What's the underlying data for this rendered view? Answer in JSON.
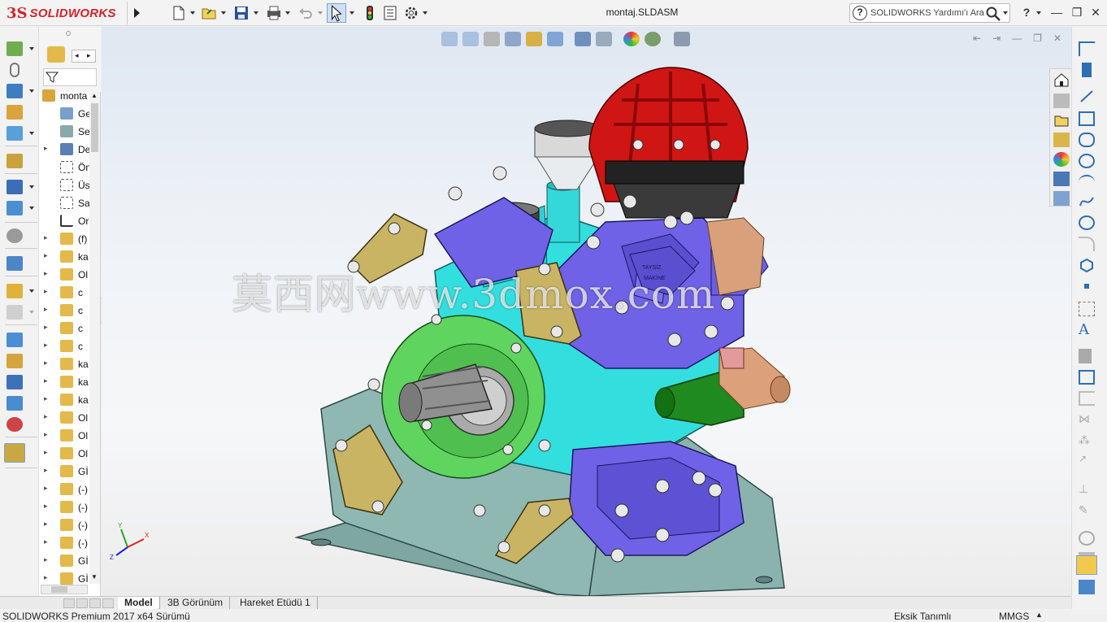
{
  "app": {
    "brand": "SOLIDWORKS",
    "document_title": "montaj.SLDASM",
    "search_placeholder": "SOLIDWORKS Yardımı'ı Ara",
    "help_label": "?"
  },
  "toolbar": {
    "icons": [
      "new-icon",
      "open-icon",
      "save-icon",
      "print-icon",
      "undo-icon",
      "select-icon",
      "rebuild-icon",
      "file-properties-icon",
      "options-icon"
    ]
  },
  "feature_tree": {
    "root_label": "monta",
    "items": [
      {
        "label": "Ge",
        "icon": "history-icon"
      },
      {
        "label": "Se",
        "icon": "sensors-icon"
      },
      {
        "label": "De",
        "icon": "annotations-icon"
      },
      {
        "label": "Ön",
        "icon": "plane-icon"
      },
      {
        "label": "Üs",
        "icon": "plane-icon"
      },
      {
        "label": "Sa",
        "icon": "plane-icon"
      },
      {
        "label": "Or",
        "icon": "origin-icon"
      },
      {
        "label": "(f)",
        "icon": "part-icon"
      },
      {
        "label": "ka",
        "icon": "part-icon"
      },
      {
        "label": "Ol",
        "icon": "part-icon"
      },
      {
        "label": "c",
        "icon": "part-icon"
      },
      {
        "label": "c",
        "icon": "part-icon"
      },
      {
        "label": "c",
        "icon": "part-icon"
      },
      {
        "label": "c",
        "icon": "part-icon"
      },
      {
        "label": "ka",
        "icon": "part-icon"
      },
      {
        "label": "ka",
        "icon": "part-icon"
      },
      {
        "label": "ka",
        "icon": "part-icon"
      },
      {
        "label": "Ol",
        "icon": "part-icon"
      },
      {
        "label": "Ol",
        "icon": "part-icon"
      },
      {
        "label": "Ol",
        "icon": "part-icon"
      },
      {
        "label": "Gİ",
        "icon": "part-icon"
      },
      {
        "label": "(-)",
        "icon": "part-icon"
      },
      {
        "label": "(-)",
        "icon": "part-icon"
      },
      {
        "label": "(-)",
        "icon": "part-icon"
      },
      {
        "label": "(-)",
        "icon": "part-icon"
      },
      {
        "label": "Gİ",
        "icon": "part-icon"
      },
      {
        "label": "Gİ",
        "icon": "part-icon"
      }
    ]
  },
  "viewport": {
    "watermark": "莫西网www.3dmox.com",
    "part_labels": {
      "pump_plate_top": "TAYSİZ",
      "pump_plate_bottom": "MAKİNE"
    }
  },
  "tabs": [
    {
      "label": "Model",
      "active": true
    },
    {
      "label": "3B Görünüm",
      "active": false
    },
    {
      "label": "Hareket Etüdü 1",
      "active": false
    }
  ],
  "status": {
    "version": "SOLIDWORKS Premium 2017 x64 Sürümü",
    "definition": "Eksik Tanımlı",
    "units": "MMGS"
  },
  "colors": {
    "brand_red": "#d2232a",
    "pump_body_cyan": "#33dede",
    "pump_housing_blue": "#6f62e6",
    "flange_green": "#5fd45f",
    "cap_red": "#d01515",
    "mount_plate": "#8fb8b3",
    "lug_khaki": "#c8b463"
  }
}
